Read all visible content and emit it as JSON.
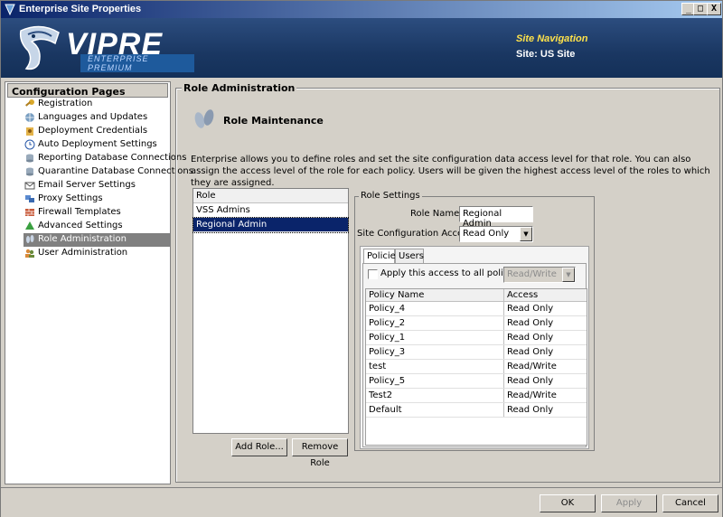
{
  "window": {
    "title": "Enterprise Site Properties",
    "min": "_",
    "max": "□",
    "close": "X"
  },
  "banner": {
    "brand": "VIPRE",
    "edition": "ENTERPRISE PREMIUM",
    "nav_title": "Site Navigation",
    "site": "Site:  US Site"
  },
  "sidebar": {
    "header": "Configuration Pages",
    "items": [
      {
        "label": "Registration",
        "icon": "key-icon"
      },
      {
        "label": "Languages and Updates",
        "icon": "globe-icon"
      },
      {
        "label": "Deployment Credentials",
        "icon": "credentials-icon"
      },
      {
        "label": "Auto Deployment Settings",
        "icon": "clock-icon"
      },
      {
        "label": "Reporting Database Connections",
        "icon": "database-icon"
      },
      {
        "label": "Quarantine Database Connections",
        "icon": "database-icon"
      },
      {
        "label": "Email Server Settings",
        "icon": "email-icon"
      },
      {
        "label": "Proxy Settings",
        "icon": "proxy-icon"
      },
      {
        "label": "Firewall Templates",
        "icon": "firewall-icon"
      },
      {
        "label": "Advanced Settings",
        "icon": "advanced-icon"
      },
      {
        "label": "Role Administration",
        "icon": "footprints-icon"
      },
      {
        "label": "User Administration",
        "icon": "users-icon"
      }
    ],
    "selected_index": 10
  },
  "main": {
    "group_title": "Role Administration",
    "section_title": "Role Maintenance",
    "description": "Enterprise allows you to define roles and set the site configuration data access level for that role. You can also assign the access level of the role for each policy.  Users will be given the highest access level of the roles to which they are assigned.",
    "roles": {
      "header": "Role",
      "items": [
        "VSS Admins",
        "Regional Admin"
      ],
      "selected": "Regional Admin"
    },
    "add_role": "Add Role...",
    "remove_role": "Remove Role",
    "role_settings": {
      "title": "Role Settings",
      "name_label": "Role Name:",
      "name_value": "Regional Admin",
      "access_label": "Site Configuration Access:",
      "access_value": "Read Only",
      "tabs": [
        "Policies",
        "Users"
      ],
      "apply_all_label": "Apply this access to all policies:",
      "apply_all_value": "Read/Write",
      "table": {
        "headers": [
          "Policy Name",
          "Access"
        ],
        "rows": [
          [
            "Policy_4",
            "Read Only"
          ],
          [
            "Policy_2",
            "Read Only"
          ],
          [
            "Policy_1",
            "Read Only"
          ],
          [
            "Policy_3",
            "Read Only"
          ],
          [
            "test",
            "Read/Write"
          ],
          [
            "Policy_5",
            "Read Only"
          ],
          [
            "Test2",
            "Read/Write"
          ],
          [
            "Default",
            "Read Only"
          ]
        ]
      }
    }
  },
  "footer": {
    "ok": "OK",
    "apply": "Apply",
    "cancel": "Cancel"
  }
}
